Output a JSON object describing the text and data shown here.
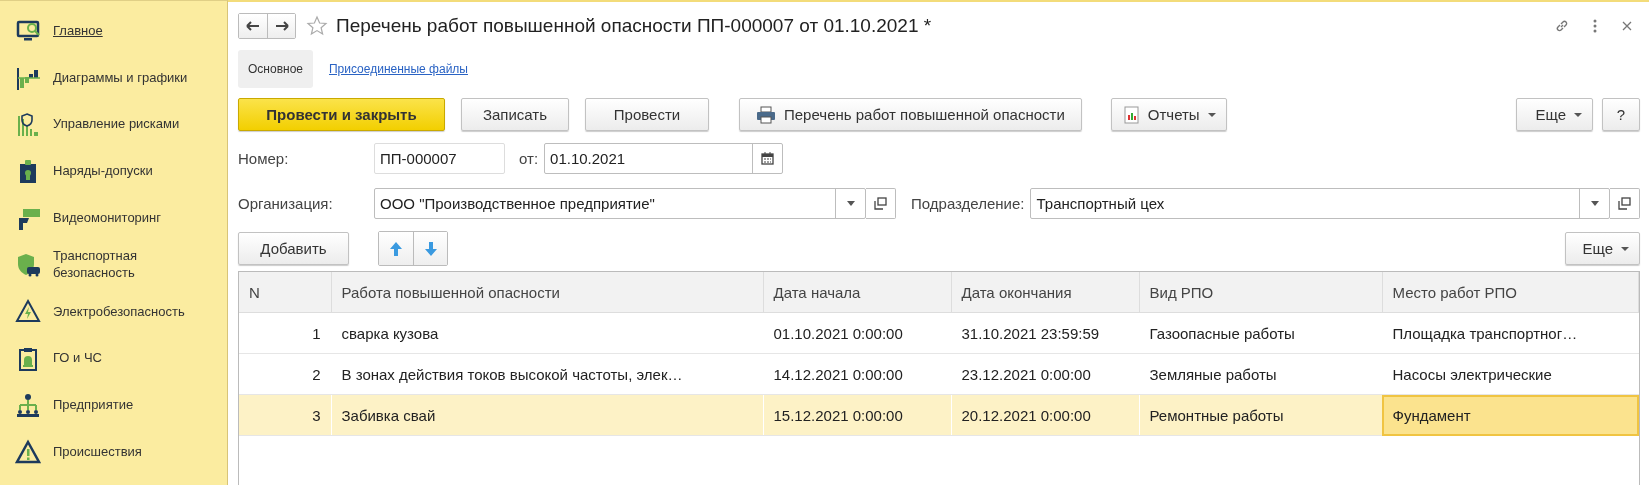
{
  "sidebar": {
    "items": [
      {
        "label": "Главное",
        "selected": true
      },
      {
        "label": "Диаграммы и графики",
        "selected": false
      },
      {
        "label": "Управление рисками",
        "selected": false
      },
      {
        "label": "Наряды-допуски",
        "selected": false
      },
      {
        "label": "Видеомониторинг",
        "selected": false
      },
      {
        "label": "Транспортная безопасность",
        "selected": false
      },
      {
        "label": "Электробезопасность",
        "selected": false
      },
      {
        "label": "ГО и ЧС",
        "selected": false
      },
      {
        "label": "Предприятие",
        "selected": false
      },
      {
        "label": "Происшествия",
        "selected": false
      }
    ]
  },
  "document": {
    "title": "Перечень работ повышенной опасности ПП-000007 от 01.10.2021 *",
    "favorite": false,
    "tabs": [
      {
        "label": "Основное",
        "selected": true
      },
      {
        "label": "Присоединенные файлы",
        "selected": false
      }
    ],
    "toolbar": [
      {
        "label": "Провести и закрыть",
        "kind": "primary"
      },
      {
        "label": "Записать",
        "kind": "plain"
      },
      {
        "label": "Провести",
        "kind": "plain"
      },
      {
        "label": "Перечень работ повышенной опасности",
        "kind": "print"
      },
      {
        "label": "Отчеты",
        "kind": "reports"
      },
      {
        "label": "Еще",
        "kind": "more"
      },
      {
        "label": "?",
        "kind": "help"
      }
    ],
    "number": {
      "label": "Номер:",
      "value": "ПП-000007"
    },
    "date": {
      "label": "от:",
      "value": "01.10.2021"
    },
    "organization": {
      "label": "Организация:",
      "value": "ООО \"Производственное предприятие\""
    },
    "department": {
      "label": "Подразделение:",
      "value": "Транспортный цех"
    },
    "table_toolbar": {
      "add": "Добавить",
      "more": "Еще"
    },
    "table": {
      "columns": [
        "N",
        "Работа повышенной опасности",
        "Дата начала",
        "Дата окончания",
        "Вид РПО",
        "Место работ РПО"
      ],
      "rows": [
        {
          "selected": false,
          "cells": [
            {
              "text": "1",
              "active": false
            },
            {
              "text": "сварка кузова",
              "active": false
            },
            {
              "text": "01.10.2021 0:00:00",
              "active": false
            },
            {
              "text": "31.10.2021 23:59:59",
              "active": false
            },
            {
              "text": "Газоопасные работы",
              "active": false
            },
            {
              "text": "Площадка транспортног…",
              "active": false
            }
          ]
        },
        {
          "selected": false,
          "cells": [
            {
              "text": "2",
              "active": false
            },
            {
              "text": "В зонах действия токов высокой частоты, элек…",
              "active": false
            },
            {
              "text": "14.12.2021 0:00:00",
              "active": false
            },
            {
              "text": "23.12.2021 0:00:00",
              "active": false
            },
            {
              "text": "Земляные работы",
              "active": false
            },
            {
              "text": "Насосы электрические",
              "active": false
            }
          ]
        },
        {
          "selected": true,
          "cells": [
            {
              "text": "3",
              "active": false
            },
            {
              "text": "Забивка свай",
              "active": false
            },
            {
              "text": "15.12.2021 0:00:00",
              "active": false
            },
            {
              "text": "20.12.2021 0:00:00",
              "active": false
            },
            {
              "text": "Ремонтные работы",
              "active": false
            },
            {
              "text": "Фундамент",
              "active": true
            }
          ]
        }
      ]
    }
  }
}
